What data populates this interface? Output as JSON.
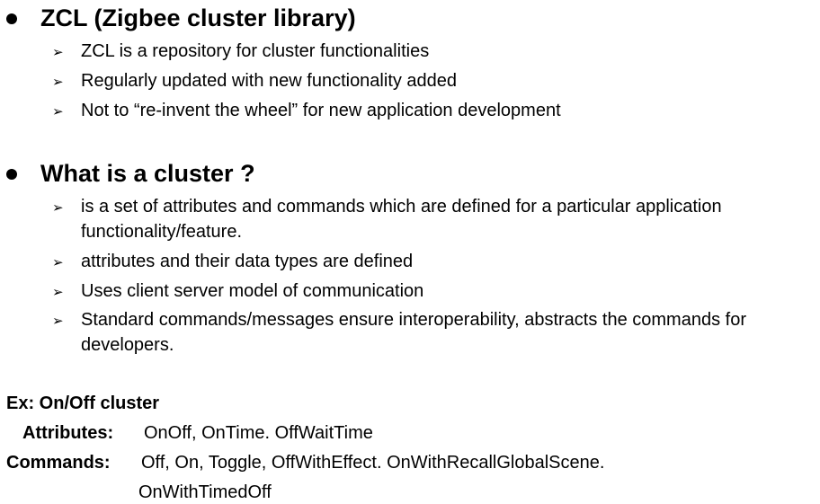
{
  "section1": {
    "heading": "ZCL (Zigbee cluster library)",
    "items": [
      "ZCL is a repository for cluster functionalities",
      "Regularly updated with new functionality added",
      "Not to “re-invent the wheel” for new application development"
    ]
  },
  "section2": {
    "heading": "What is a cluster ?",
    "items": [
      "is a set of attributes and commands which are defined for a particular application functionality/feature.",
      "attributes and their data types are defined",
      "Uses client server model of communication",
      "Standard commands/messages ensure interoperability, abstracts the commands for developers."
    ]
  },
  "example": {
    "title": "Ex: On/Off cluster",
    "attributes_label": "Attributes:",
    "attributes_value": "OnOff, OnTime. OffWaitTime",
    "commands_label": "Commands:",
    "commands_value_line1": "Off, On, Toggle, OffWithEffect. OnWithRecallGlobalScene.",
    "commands_value_line2": "OnWithTimedOff"
  },
  "icons": {
    "bullet": "filled-circle-bullet-icon",
    "sub_bullet": "arrowhead-bullet-icon"
  },
  "arrow_glyph": "➢"
}
